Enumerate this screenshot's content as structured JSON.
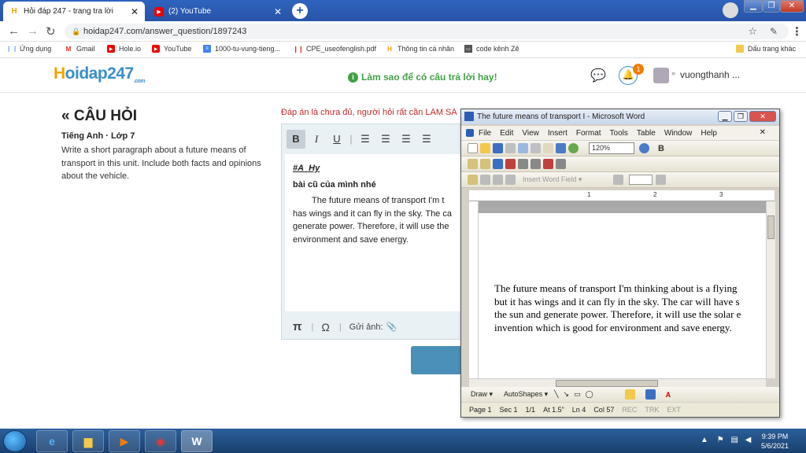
{
  "browser": {
    "tabs": [
      {
        "title": "Hỏi đáp 247 - trang tra lời",
        "icon": "hoidap-favicon"
      },
      {
        "title": "(2) YouTube",
        "icon": "youtube-favicon"
      }
    ],
    "url": "hoidap247.com/answer_question/1897243",
    "bookmarks": [
      {
        "label": "Ứng dụng",
        "icon": "apps-icon"
      },
      {
        "label": "Gmail",
        "icon": "gmail-icon"
      },
      {
        "label": "Hole.io",
        "icon": "youtube-favicon"
      },
      {
        "label": "YouTube",
        "icon": "youtube-favicon"
      },
      {
        "label": "1000-tu-vung-tieng...",
        "icon": "docs-icon"
      },
      {
        "label": "CPE_useofenglish.pdf",
        "icon": "pdf-icon"
      },
      {
        "label": "Thông tin cá nhân",
        "icon": "hoidap-favicon"
      },
      {
        "label": "code kênh Zê",
        "icon": "sheet-icon"
      },
      {
        "label": "Dấu trang khác",
        "icon": "folder-icon"
      }
    ]
  },
  "site": {
    "logo_prefix": "H",
    "logo_rest": "oidap247",
    "logo_sub": ".com",
    "tip": "Làm sao để có câu trả lời hay!",
    "notification_count": "1",
    "username": "vuongthanh ..."
  },
  "question": {
    "heading": "CÂU HỎI",
    "subject": "Tiếng Anh · Lớp 7",
    "text": "Write a short paragraph about a future means of transport in this unit. Include both facts and opinions about the vehicle."
  },
  "answer": {
    "notice": "Đáp án là chưa đủ, người hỏi rất cần LÀM SÁ",
    "mention": "#A_Hy",
    "intro": "bài cũ của mình nhé",
    "body": "The future means of transport I'm t has wings and it can fly in the sky. The ca generate power. Therefore, it will use the environment and save energy.",
    "upload_label": "Gửi ảnh:"
  },
  "word": {
    "title": "The future means of transport I - Microsoft Word",
    "menu": [
      "File",
      "Edit",
      "View",
      "Insert",
      "Format",
      "Tools",
      "Table",
      "Window",
      "Help"
    ],
    "zoom": "120%",
    "insert_field": "Insert Word Field ▾",
    "doc_lines": [
      "The future means of transport I'm thinking about is a flying",
      "but it has wings and it can fly in the sky. The car will have s",
      "the sun and generate power. Therefore, it will use the solar e",
      "invention which is good for environment and save energy."
    ],
    "draw_label": "Draw ▾",
    "autoshapes_label": "AutoShapes ▾",
    "status": {
      "page": "Page 1",
      "sec": "Sec 1",
      "pages": "1/1",
      "at": "At 1.5\"",
      "ln": "Ln 4",
      "col": "Col 57",
      "rec": "REC",
      "trk": "TRK",
      "ext": "EXT"
    }
  },
  "taskbar": {
    "time": "9:39 PM",
    "date": "5/6/2021"
  }
}
